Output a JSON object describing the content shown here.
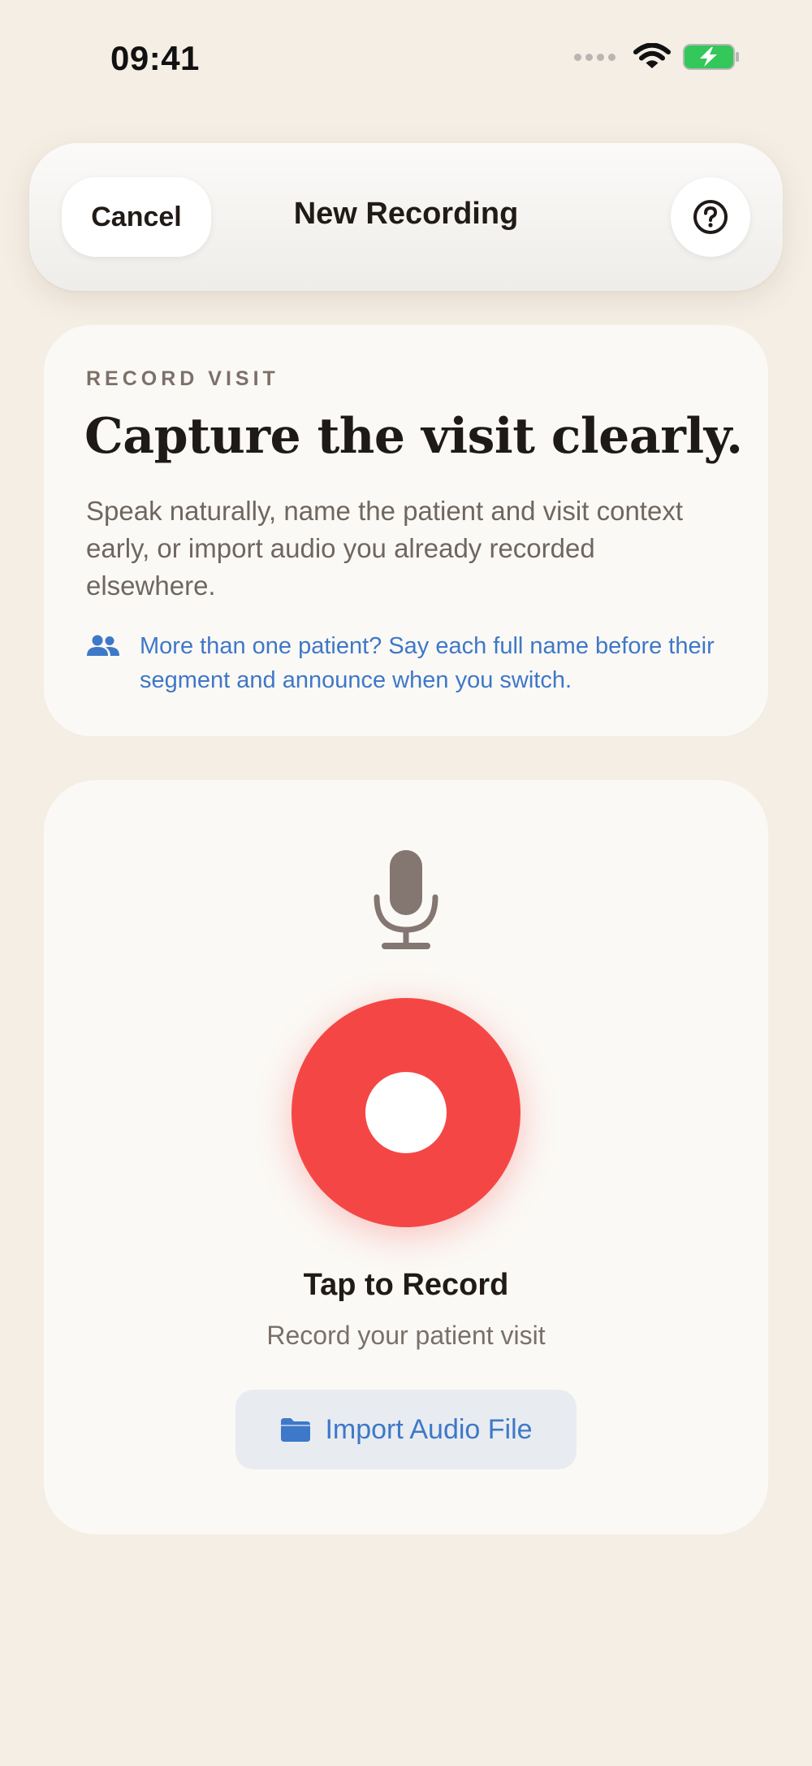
{
  "status_bar": {
    "time": "09:41",
    "signal_icon": "cellular-dots",
    "wifi_icon": "wifi-icon",
    "battery_icon": "battery-charging-icon"
  },
  "nav": {
    "cancel_label": "Cancel",
    "title": "New Recording",
    "help_icon": "question-circle-icon"
  },
  "intro": {
    "eyebrow": "RECORD VISIT",
    "headline": "Capture the visit clearly.",
    "body": "Speak naturally, name the patient and visit context early, or import audio you already recorded elsewhere.",
    "tip_icon": "people-icon",
    "tip": "More than one patient? Say each full name before their segment and announce when you switch."
  },
  "recorder": {
    "mic_icon": "microphone-icon",
    "record_button_icon": "record-icon",
    "title": "Tap to Record",
    "subtitle": "Record your patient visit",
    "import_icon": "folder-icon",
    "import_label": "Import Audio File"
  },
  "colors": {
    "background": "#f5eee4",
    "card": "#fbf9f5",
    "accent_blue": "#3e78c8",
    "record_red": "#f44745",
    "battery_green": "#34c759"
  }
}
